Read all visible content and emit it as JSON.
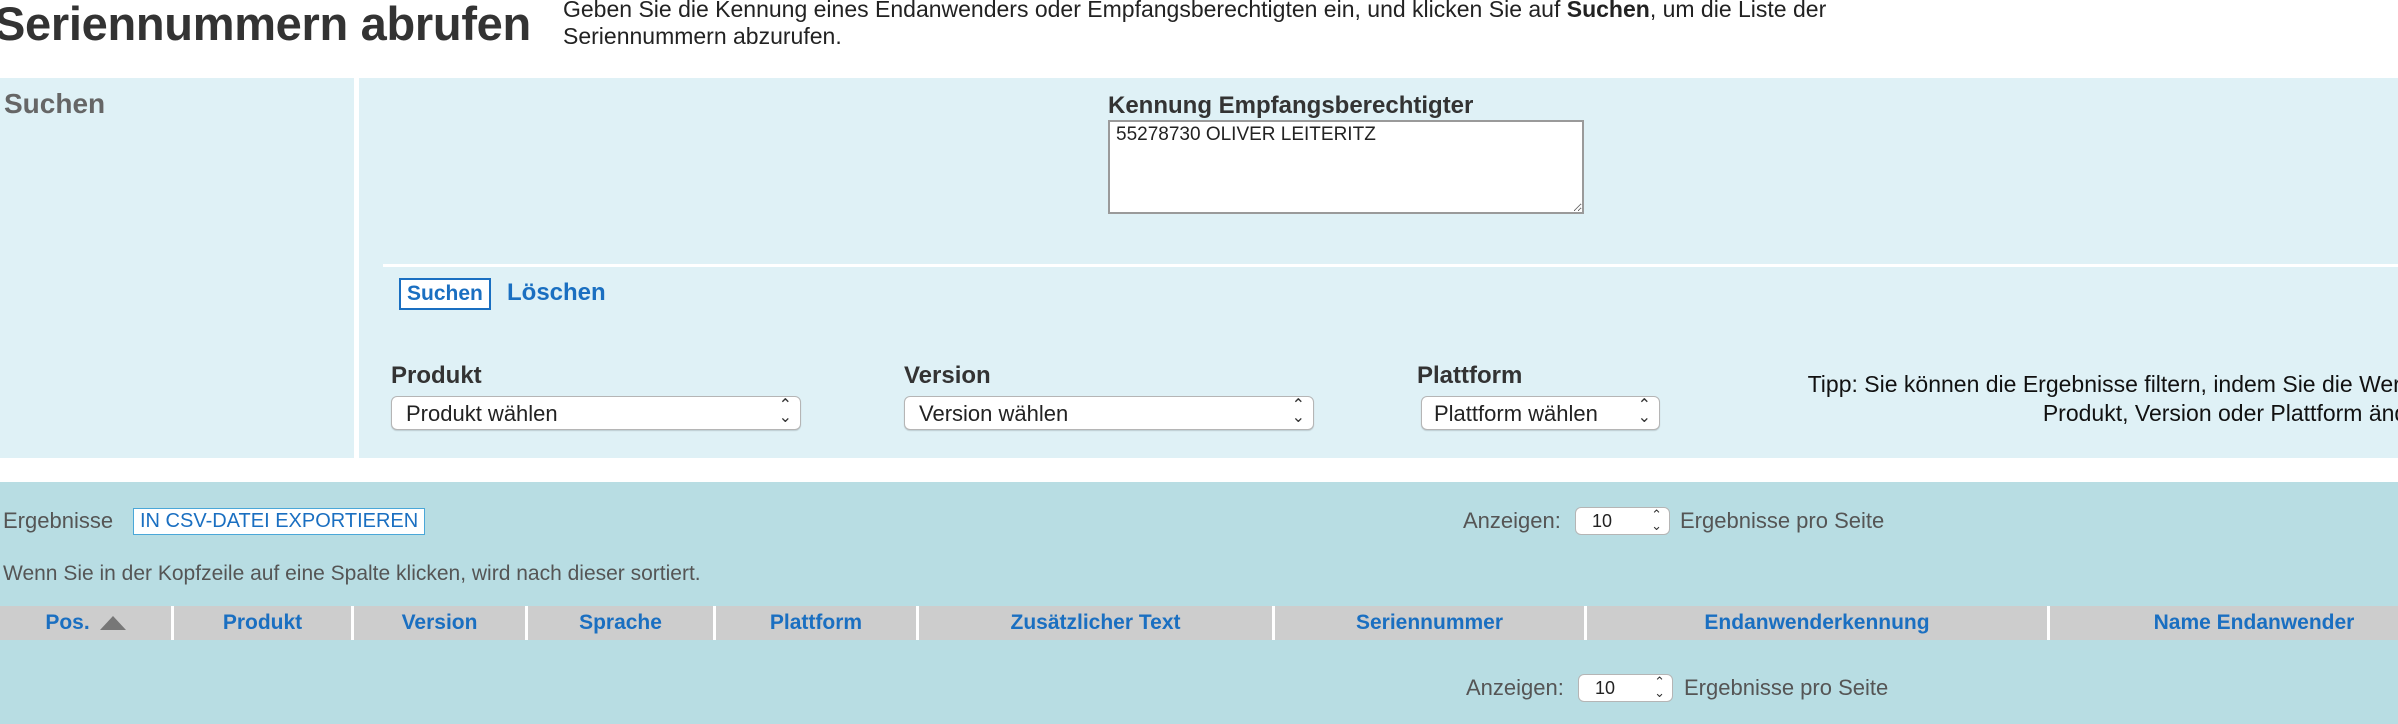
{
  "header": {
    "title": "Seriennummern abrufen",
    "intro_part1": "Geben Sie die Kennung eines Endanwenders oder Empfangsberechtigten ein, und klicken Sie auf ",
    "intro_bold": "Suchen",
    "intro_part2": ", um die Liste der Seriennummern abzurufen."
  },
  "search": {
    "heading": "Suchen",
    "recipient_label": "Kennung Empfangsberechtigter",
    "recipient_value": "55278730 OLIVER LEITERITZ",
    "search_button": "Suchen",
    "clear_link": "Löschen",
    "filters": {
      "product": {
        "label": "Produkt",
        "selected": "Produkt wählen"
      },
      "version": {
        "label": "Version",
        "selected": "Version wählen"
      },
      "platform": {
        "label": "Plattform",
        "selected": "Plattform wählen"
      }
    },
    "tip_line1": "Tipp: Sie können die Ergebnisse filtern, indem Sie die Werte",
    "tip_line2": "Produkt, Version oder Plattform ände"
  },
  "results": {
    "label": "Ergebnisse",
    "export_button": "IN CSV-DATEI EXPORTIEREN",
    "show_label": "Anzeigen:",
    "page_size": "10",
    "per_page_label": "Ergebnisse pro Seite",
    "sort_hint": "Wenn Sie in der Kopfzeile auf eine Spalte klicken, wird nach dieser sortiert.",
    "columns": [
      "Pos.",
      "Produkt",
      "Version",
      "Sprache",
      "Plattform",
      "Zusätzlicher Text",
      "Seriennummer",
      "Endanwenderkennung",
      "Name Endanwender"
    ]
  }
}
